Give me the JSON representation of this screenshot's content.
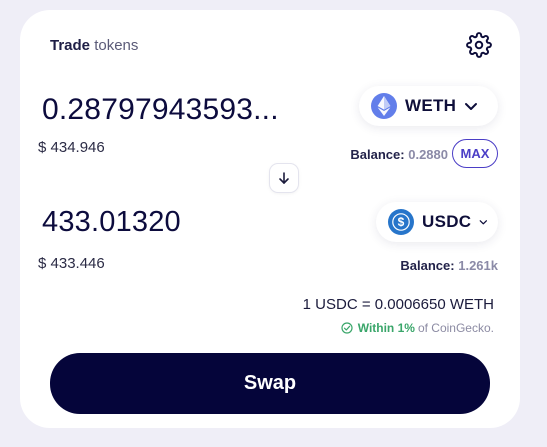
{
  "header": {
    "title_strong": "Trade",
    "title_light": "tokens",
    "settings_icon": "gear-icon"
  },
  "from": {
    "amount": "0.28797943593...",
    "usd_value": "$ 434.946",
    "token": "WETH",
    "token_icon": "ethereum-icon",
    "balance_label": "Balance:",
    "balance_value": "0.2880",
    "max_label": "MAX"
  },
  "switch_icon": "arrow-down-icon",
  "to": {
    "amount": "433.01320",
    "usd_value": "$ 433.446",
    "token": "USDC",
    "token_icon": "usdc-icon",
    "balance_label": "Balance:",
    "balance_value": "1.261k"
  },
  "rate": {
    "text": "1 USDC = 0.0006650 WETH",
    "within_label": "Within 1%",
    "source_text": "of CoinGecko."
  },
  "swap_button": "Swap",
  "colors": {
    "background": "#efeef7",
    "card": "#ffffff",
    "primary_dark": "#05053a",
    "accent": "#4b3ec6",
    "success": "#3aa66a",
    "eth": "#627eea",
    "usdc": "#2775ca"
  }
}
